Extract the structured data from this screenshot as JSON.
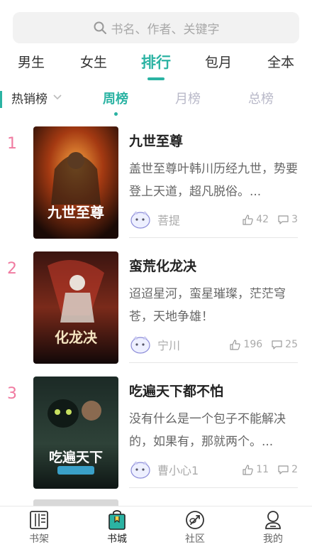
{
  "search": {
    "placeholder": "书名、作者、关键字"
  },
  "tabs": [
    {
      "label": "男生"
    },
    {
      "label": "女生"
    },
    {
      "label": "排行",
      "active": true
    },
    {
      "label": "包月"
    },
    {
      "label": "全本"
    }
  ],
  "filter": {
    "category": "热销榜",
    "periods": [
      {
        "label": "周榜",
        "active": true
      },
      {
        "label": "月榜"
      },
      {
        "label": "总榜"
      }
    ]
  },
  "books": [
    {
      "rank": "1",
      "title": "九世至尊",
      "desc": "盖世至尊叶韩川历经九世，势要登上天道，超凡脱俗。...",
      "author": "菩提",
      "likes": "42",
      "comments": "3",
      "cover_text": "九世至尊"
    },
    {
      "rank": "2",
      "title": "蛮荒化龙决",
      "desc": "迢迢星河，蛮星璀璨，茫茫穹苍，天地争雄！",
      "author": "宁川",
      "likes": "196",
      "comments": "25",
      "cover_text": "化龙决"
    },
    {
      "rank": "3",
      "title": "吃遍天下都不怕",
      "desc": "没有什么是一个包子不能解决的，如果有，那就两个。...",
      "author": "曹小心1",
      "likes": "11",
      "comments": "2",
      "cover_text": "吃遍天下"
    }
  ],
  "nav": [
    {
      "label": "书架",
      "icon": "bookshelf-icon"
    },
    {
      "label": "书城",
      "icon": "bookstore-icon",
      "active": true
    },
    {
      "label": "社区",
      "icon": "community-icon"
    },
    {
      "label": "我的",
      "icon": "profile-icon"
    }
  ],
  "colors": {
    "accent": "#2bb3a3",
    "rank": "#f07aa0"
  }
}
